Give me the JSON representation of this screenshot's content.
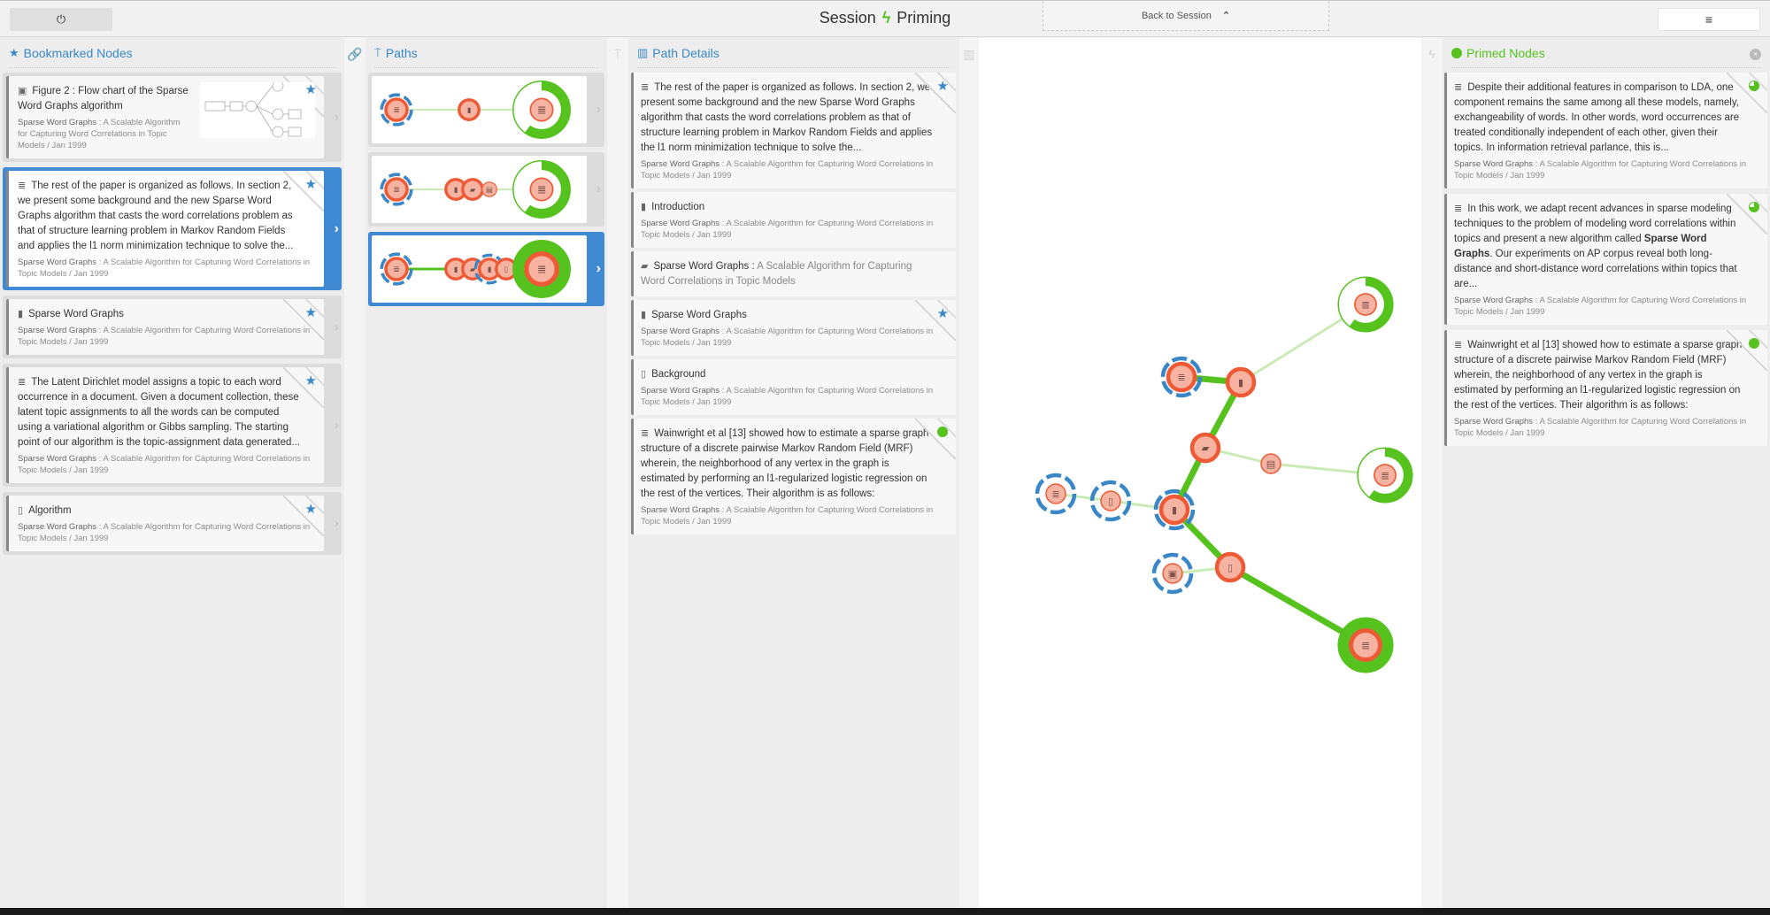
{
  "header": {
    "power_icon": "⏻",
    "title_left": "Session",
    "title_bolt": "ϟ",
    "title_right": "Priming",
    "back_label": "Back to Session",
    "back_chevron": "⌃",
    "menu_icon": "≡"
  },
  "colors": {
    "accent_blue": "#3a87c8",
    "primed_green": "#55c21e",
    "node_orange": "#ee5a35",
    "node_fill": "#f7b3a2"
  },
  "bookmarked": {
    "title": "Bookmarked Nodes",
    "icon": "star-icon",
    "items": [
      {
        "type": "image",
        "text": "Figure 2 : Flow chart of the Sparse Word Graphs algorithm",
        "meta_title": "Sparse Word Graphs",
        "meta_rest": " : A Scalable Algorithm for Capturing Word Correlations in Topic Models / Jan 1999",
        "starred": true,
        "selected": false
      },
      {
        "type": "paragraph",
        "text": "The rest of the paper is organized as follows. In section 2, we present some background and the new Sparse Word Graphs algorithm that casts the word correlations problem as that of structure learning problem in Markov Random Fields and applies the l1 norm minimization technique to solve the...",
        "meta_title": "Sparse Word Graphs",
        "meta_rest": " : A Scalable Algorithm for Capturing Word Correlations in Topic Models / Jan 1999",
        "starred": true,
        "selected": true
      },
      {
        "type": "section",
        "text": "Sparse Word Graphs",
        "meta_title": "Sparse Word Graphs",
        "meta_rest": " : A Scalable Algorithm for Capturing Word Correlations in Topic Models / Jan 1999",
        "starred": true,
        "selected": false
      },
      {
        "type": "paragraph",
        "text": "The Latent Dirichlet model assigns a topic to each word occurrence in a document. Given a document collection, these latent topic assignments to all the words can be computed using a variational algorithm or Gibbs sampling. The starting point of our algorithm is the topic-assignment data generated...",
        "meta_title": "Sparse Word Graphs",
        "meta_rest": " : A Scalable Algorithm for Capturing Word Correlations in Topic Models / Jan 1999",
        "starred": true,
        "selected": false
      },
      {
        "type": "subsection",
        "text": "Algorithm",
        "meta_title": "Sparse Word Graphs",
        "meta_rest": " : A Scalable Algorithm for Capturing Word Correlations in Topic Models / Jan 1999",
        "starred": true,
        "selected": false
      }
    ]
  },
  "paths": {
    "title": "Paths",
    "icon": "signpost-icon",
    "items": [
      {
        "middle_nodes": [
          "section"
        ],
        "primed_fraction": 0.6,
        "selected": false
      },
      {
        "middle_nodes": [
          "section",
          "document",
          "header"
        ],
        "primed_fraction": 0.6,
        "selected": false
      },
      {
        "middle_nodes": [
          "section",
          "document",
          "section",
          "subsection"
        ],
        "primed_fraction": 1.0,
        "selected": true
      }
    ]
  },
  "path_details": {
    "title": "Path Details",
    "icon": "map-icon",
    "items": [
      {
        "type": "paragraph",
        "text": "The rest of the paper is organized as follows. In section 2, we present some background and the new Sparse Word Graphs algorithm that casts the word correlations problem as that of structure learning problem in Markov Random Fields and applies the l1 norm minimization technique to solve the...",
        "meta_title": "Sparse Word Graphs",
        "meta_rest": " : A Scalable Algorithm for Capturing Word Correlations in Topic Models / Jan 1999",
        "badge": "star"
      },
      {
        "type": "section",
        "text": "Introduction",
        "meta_title": "Sparse Word Graphs",
        "meta_rest": " : A Scalable Algorithm for Capturing Word Correlations in Topic Models / Jan 1999",
        "badge": ""
      },
      {
        "type": "document",
        "text": "Sparse Word Graphs :",
        "text_rest": " A Scalable Algorithm for Capturing Word Correlations in Topic Models",
        "badge": ""
      },
      {
        "type": "section",
        "text": "Sparse Word Graphs",
        "meta_title": "Sparse Word Graphs",
        "meta_rest": " : A Scalable Algorithm for Capturing Word Correlations in Topic Models / Jan 1999",
        "badge": "star"
      },
      {
        "type": "subsection",
        "text": "Background",
        "meta_title": "Sparse Word Graphs",
        "meta_rest": " : A Scalable Algorithm for Capturing Word Correlations in Topic Models / Jan 1999",
        "badge": ""
      },
      {
        "type": "paragraph",
        "text": "Wainwright et al [13] showed how to estimate a sparse graph structure of a discrete pairwise Markov Random Field (MRF) wherein, the neighborhood of any vertex in the graph is estimated by performing an l1-regularized logistic regression on the rest of the vertices. Their algorithm is as follows:",
        "meta_title": "Sparse Word Graphs",
        "meta_rest": " : A Scalable Algorithm for Capturing Word Correlations in Topic Models / Jan 1999",
        "badge": "primed"
      }
    ]
  },
  "primed": {
    "title": "Primed Nodes",
    "close_icon": "×",
    "items": [
      {
        "type": "paragraph",
        "text": "Despite their additional features in comparison to LDA, one component remains the same among all these models, namely, exchangeability of words. In other words, word occurrences are treated conditionally independent of each other, given their topics. In information retrieval parlance, this is...",
        "meta_title": "Sparse Word Graphs",
        "meta_rest": " : A Scalable Algorithm for Capturing Word Correlations in Topic Models / Jan 1999",
        "primed_fraction": 0.75
      },
      {
        "type": "paragraph",
        "text_before": "In this work, we adapt recent advances in sparse modeling techniques to the problem of modeling word correlations within topics and present a new algorithm called ",
        "text_bold": "Sparse Word Graphs",
        "text_after": ". Our experiments on AP corpus reveal both long-distance and short-distance word correlations within topics that are...",
        "meta_title": "Sparse Word Graphs",
        "meta_rest": " : A Scalable Algorithm for Capturing Word Correlations in Topic Models / Jan 1999",
        "primed_fraction": 0.75
      },
      {
        "type": "paragraph",
        "text": "Wainwright et al [13] showed how to estimate a sparse graph structure of a discrete pairwise Markov Random Field (MRF) wherein, the neighborhood of any vertex in the graph is estimated by performing an l1-regularized logistic regression on the rest of the vertices. Their algorithm is as follows:",
        "meta_title": "Sparse Word Graphs",
        "meta_rest": " : A Scalable Algorithm for Capturing Word Correlations in Topic Models / Jan 1999",
        "primed_fraction": 1.0
      }
    ]
  },
  "graph": {
    "nodes": [
      {
        "id": "p1",
        "type": "paragraph",
        "bookmarked": true,
        "in_path": false,
        "primed": 0
      },
      {
        "id": "s1",
        "type": "subsection",
        "bookmarked": true,
        "in_path": false,
        "primed": 0
      },
      {
        "id": "s2",
        "type": "section",
        "bookmarked": true,
        "in_path": true,
        "primed": 0
      },
      {
        "id": "d1",
        "type": "document",
        "bookmarked": false,
        "in_path": true,
        "primed": 0
      },
      {
        "id": "s3",
        "type": "section",
        "bookmarked": false,
        "in_path": true,
        "primed": 0
      },
      {
        "id": "p2",
        "type": "paragraph",
        "bookmarked": true,
        "in_path": true,
        "primed": 0
      },
      {
        "id": "h1",
        "type": "header",
        "bookmarked": false,
        "in_path": false,
        "primed": 0
      },
      {
        "id": "pr1",
        "type": "paragraph",
        "bookmarked": false,
        "in_path": false,
        "primed": 0.6
      },
      {
        "id": "pr2",
        "type": "paragraph",
        "bookmarked": false,
        "in_path": false,
        "primed": 0.6
      },
      {
        "id": "i1",
        "type": "image",
        "bookmarked": true,
        "in_path": false,
        "primed": 0
      },
      {
        "id": "ss1",
        "type": "subsection",
        "bookmarked": false,
        "in_path": true,
        "primed": 0
      },
      {
        "id": "pr3",
        "type": "paragraph",
        "bookmarked": false,
        "in_path": true,
        "primed": 1.0
      }
    ],
    "edges": [
      {
        "from": "p1",
        "to": "s1",
        "path": false
      },
      {
        "from": "s1",
        "to": "s2",
        "path": false
      },
      {
        "from": "p2",
        "to": "s3",
        "path": true
      },
      {
        "from": "s3",
        "to": "d1",
        "path": true
      },
      {
        "from": "d1",
        "to": "s2",
        "path": true
      },
      {
        "from": "s3",
        "to": "pr1",
        "path": false
      },
      {
        "from": "d1",
        "to": "h1",
        "path": false
      },
      {
        "from": "h1",
        "to": "pr2",
        "path": false
      },
      {
        "from": "s2",
        "to": "ss1",
        "path": true
      },
      {
        "from": "i1",
        "to": "ss1",
        "path": false
      },
      {
        "from": "ss1",
        "to": "pr3",
        "path": true
      }
    ]
  }
}
